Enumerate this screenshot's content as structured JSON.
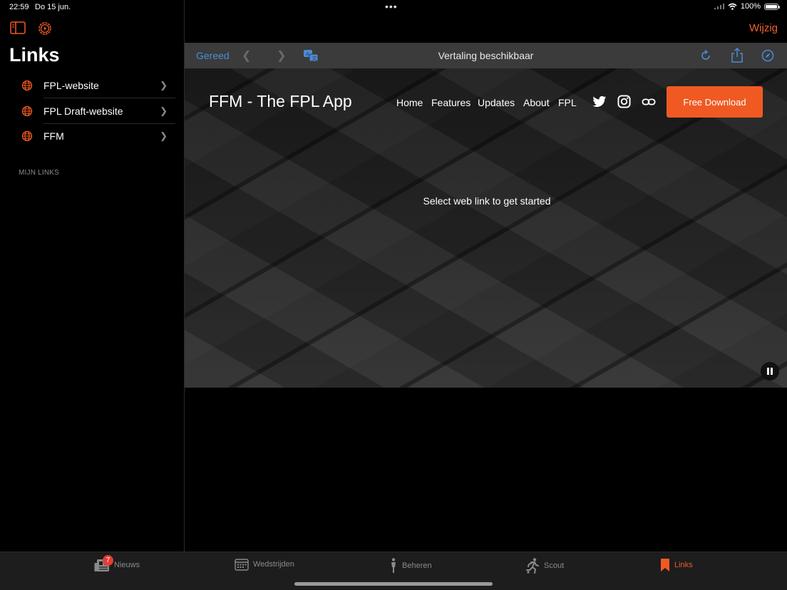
{
  "status": {
    "time": "22:59",
    "date": "Do 15 jun.",
    "battery": "100%"
  },
  "sidebar": {
    "edit_label": "Wijzig",
    "title": "Links",
    "items": [
      {
        "label": "FPL-website"
      },
      {
        "label": "FPL Draft-website"
      },
      {
        "label": "FFM"
      }
    ],
    "section_label": "MIJN LINKS"
  },
  "browser": {
    "done_label": "Gereed",
    "title": "Vertaling beschikbaar"
  },
  "website": {
    "logo": "FFM - The FPL App",
    "nav": [
      "Home",
      "Features",
      "Updates",
      "About",
      "FPL"
    ],
    "download_label": "Free Download",
    "message": "Select web link to get started"
  },
  "tabs": [
    {
      "label": "Nieuws",
      "badge": "7"
    },
    {
      "label": "Wedstrijden"
    },
    {
      "label": "Beheren"
    },
    {
      "label": "Scout"
    },
    {
      "label": "Links"
    }
  ],
  "colors": {
    "accent": "#f05a22",
    "link_blue": "#4a8cd8",
    "badge": "#e53b36"
  }
}
